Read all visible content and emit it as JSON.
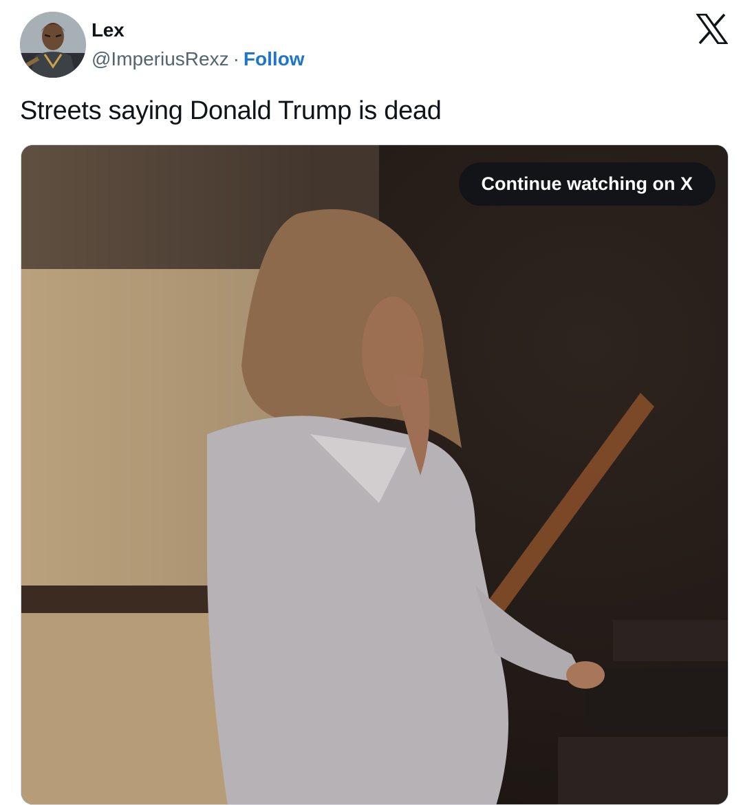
{
  "author": {
    "display_name": "Lex",
    "handle": "@ImperiusRexz",
    "separator": "·",
    "follow_label": "Follow"
  },
  "tweet": {
    "text": "Streets saying Donald Trump is dead"
  },
  "media": {
    "cta_label": "Continue watching on X"
  },
  "icons": {
    "brand": "x-logo-icon"
  },
  "colors": {
    "follow": "#1d76c9",
    "cta_bg": "#121417"
  }
}
